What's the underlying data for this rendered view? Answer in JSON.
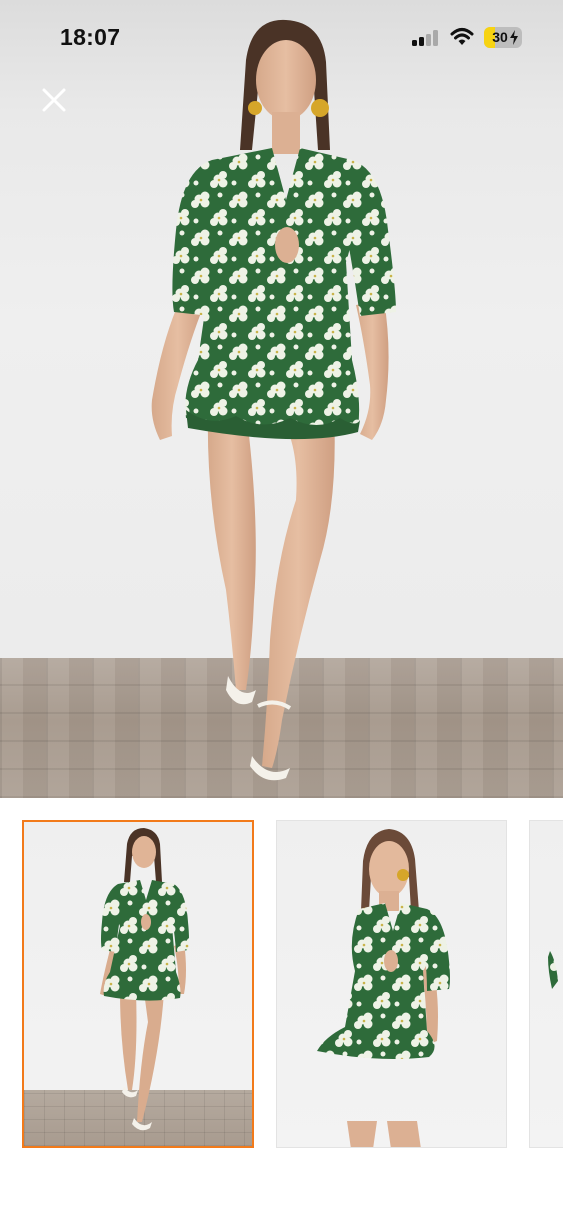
{
  "status_bar": {
    "time": "18:07",
    "signal_bars_filled": 2,
    "signal_bars_total": 4,
    "battery_percent": "30",
    "battery_level": 0.3,
    "charging": true,
    "icons": [
      "cellular-signal-icon",
      "wifi-icon",
      "battery-charging-icon"
    ]
  },
  "viewer": {
    "close_icon": "close-icon",
    "main_image": "product-photo-front",
    "selected_thumbnail": 0
  },
  "thumbnails": [
    {
      "name": "thumbnail-front-full",
      "selected": true
    },
    {
      "name": "thumbnail-front-closeup",
      "selected": false
    },
    {
      "name": "thumbnail-partial",
      "selected": false
    }
  ],
  "colors": {
    "selected_border": "#f27a1a",
    "battery_fill": "#f7d312",
    "dress_green": "#2e6b3a",
    "flower_white": "#eef2e6"
  }
}
